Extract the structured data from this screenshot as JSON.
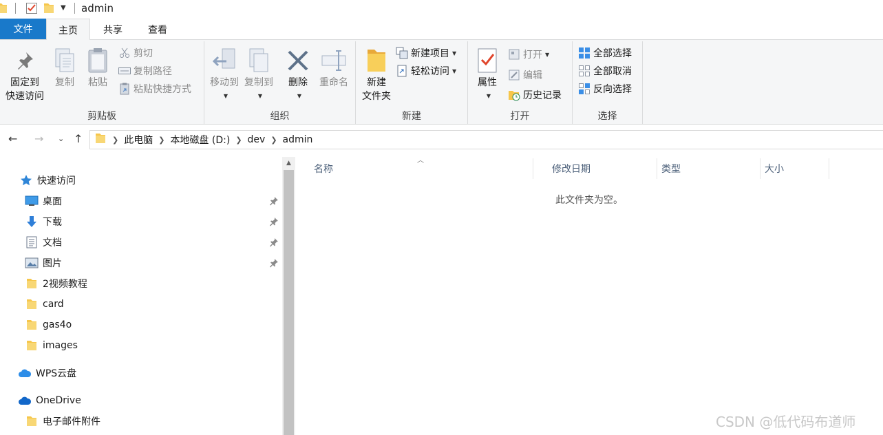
{
  "window": {
    "title": "admin"
  },
  "tabs": {
    "file": "文件",
    "home": "主页",
    "share": "共享",
    "view": "查看"
  },
  "ribbon": {
    "clipboard": {
      "label": "剪贴板",
      "pin_line1": "固定到",
      "pin_line2": "快速访问",
      "copy": "复制",
      "paste": "粘贴",
      "cut": "剪切",
      "copy_path": "复制路径",
      "paste_shortcut": "粘贴快捷方式"
    },
    "organize": {
      "label": "组织",
      "move_to": "移动到",
      "copy_to": "复制到",
      "delete": "删除",
      "rename": "重命名"
    },
    "new": {
      "label": "新建",
      "new_folder_line1": "新建",
      "new_folder_line2": "文件夹",
      "new_item": "新建项目",
      "easy_access": "轻松访问"
    },
    "open": {
      "label": "打开",
      "properties": "属性",
      "open": "打开",
      "edit": "编辑",
      "history": "历史记录"
    },
    "select": {
      "label": "选择",
      "select_all": "全部选择",
      "select_none": "全部取消",
      "invert": "反向选择"
    }
  },
  "address": {
    "crumbs": [
      "此电脑",
      "本地磁盘 (D:)",
      "dev",
      "admin"
    ]
  },
  "sidebar": {
    "quick_access": "快速访问",
    "items": [
      {
        "label": "桌面",
        "icon": "desktop-icon",
        "pinned": true
      },
      {
        "label": "下载",
        "icon": "download-icon",
        "pinned": true
      },
      {
        "label": "文档",
        "icon": "document-icon",
        "pinned": true
      },
      {
        "label": "图片",
        "icon": "pictures-icon",
        "pinned": true
      },
      {
        "label": "2视频教程",
        "icon": "folder-icon",
        "pinned": false
      },
      {
        "label": "card",
        "icon": "folder-icon",
        "pinned": false
      },
      {
        "label": "gas4o",
        "icon": "folder-icon",
        "pinned": false
      },
      {
        "label": "images",
        "icon": "folder-icon",
        "pinned": false
      }
    ],
    "wps": "WPS云盘",
    "onedrive": "OneDrive",
    "onedrive_child": "电子邮件附件"
  },
  "content": {
    "columns": [
      "名称",
      "修改日期",
      "类型",
      "大小"
    ],
    "empty_message": "此文件夹为空。"
  },
  "watermark": "CSDN @低代码布道师",
  "colors": {
    "accent": "#1979ca",
    "folder": "#f6c64b",
    "ribbon_bg": "#f5f6f7"
  }
}
